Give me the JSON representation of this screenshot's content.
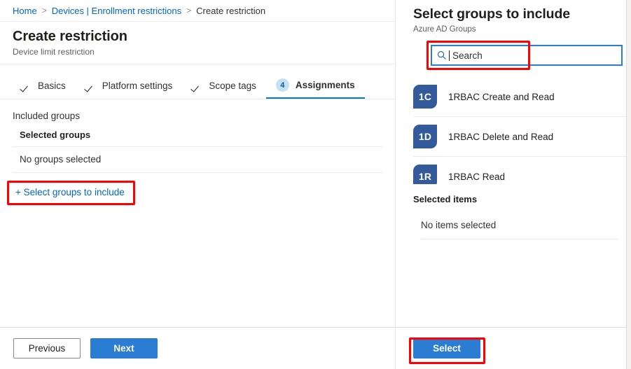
{
  "breadcrumb": {
    "items": [
      {
        "label": "Home",
        "type": "link"
      },
      {
        "label": "Devices | Enrollment restrictions",
        "type": "link"
      },
      {
        "label": "Create restriction",
        "type": "current"
      }
    ],
    "separator": ">"
  },
  "blade": {
    "title": "Create restriction",
    "subtitle": "Device limit restriction",
    "tabs": [
      {
        "label": "Basics",
        "state": "complete",
        "marker": "check"
      },
      {
        "label": "Platform settings",
        "state": "complete",
        "marker": "check"
      },
      {
        "label": "Scope tags",
        "state": "complete",
        "marker": "check"
      },
      {
        "label": "Assignments",
        "state": "active",
        "marker": "4"
      }
    ],
    "section_label": "Included groups",
    "grid": {
      "header": "Selected groups",
      "empty_row": "No groups selected"
    },
    "add_link": "+ Select groups to include",
    "footer": {
      "previous_label": "Previous",
      "next_label": "Next"
    }
  },
  "panel": {
    "title": "Select groups to include",
    "subtitle": "Azure AD Groups",
    "search": {
      "value": "",
      "placeholder": "Search",
      "icon": "search-icon"
    },
    "groups": [
      {
        "initials": "1C",
        "name": "1RBAC Create and Read"
      },
      {
        "initials": "1D",
        "name": "1RBAC Delete and Read"
      },
      {
        "initials": "1R",
        "name": "1RBAC Read"
      }
    ],
    "selected": {
      "header": "Selected items",
      "empty": "No items selected"
    },
    "footer": {
      "select_label": "Select"
    }
  },
  "colors": {
    "accent": "#0078d4",
    "primary_button": "#2b7cd3",
    "link": "#0066cc",
    "avatar": "#335b9c",
    "highlight": "#ff0000",
    "badge_bg": "#c7e0f4",
    "badge_text": "#005a9e"
  }
}
